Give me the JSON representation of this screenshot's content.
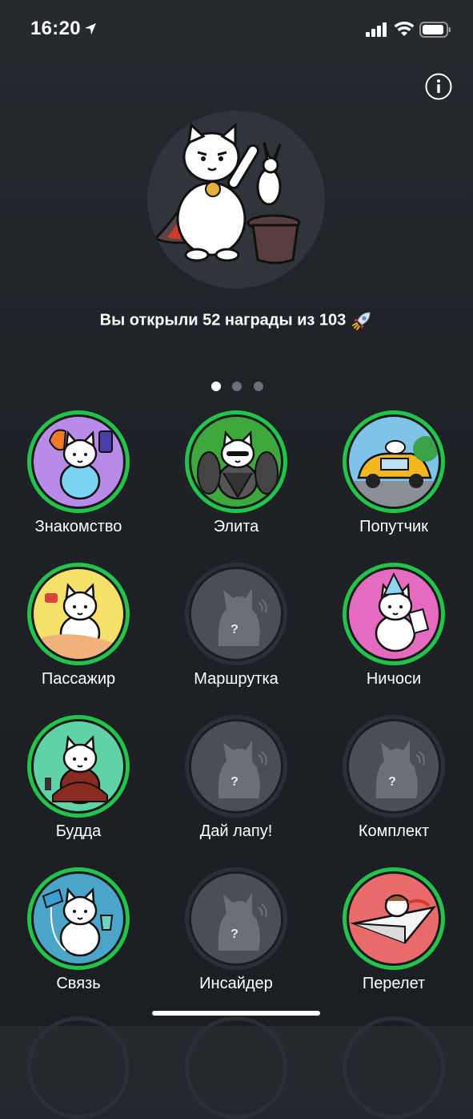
{
  "status_bar": {
    "time": "16:20"
  },
  "summary": {
    "text": "Вы открыли 52 награды из 103",
    "emoji": "rocket"
  },
  "pager": {
    "pages": 3,
    "active": 0
  },
  "colors": {
    "ring_open": "#22c44a",
    "ring_locked": "#2b3036",
    "background": "#1e2227"
  },
  "badges": [
    {
      "label": "Знакомство",
      "state": "open",
      "art": "selfie",
      "bg": "#b98be8"
    },
    {
      "label": "Элита",
      "state": "open",
      "art": "elite",
      "bg": "#3fa83c"
    },
    {
      "label": "Попутчик",
      "state": "open",
      "art": "car",
      "bg": "#7fc4e8"
    },
    {
      "label": "Пассажир",
      "state": "open",
      "art": "passenger",
      "bg": "#f5e06a"
    },
    {
      "label": "Маршрутка",
      "state": "locked",
      "art": "locked"
    },
    {
      "label": "Ничоси",
      "state": "open",
      "art": "party",
      "bg": "#e56bc0"
    },
    {
      "label": "Будда",
      "state": "open",
      "art": "buddha",
      "bg": "#5fd3a6"
    },
    {
      "label": "Дай лапу!",
      "state": "locked",
      "art": "locked"
    },
    {
      "label": "Комплект",
      "state": "locked",
      "art": "locked"
    },
    {
      "label": "Связь",
      "state": "open",
      "art": "phone",
      "bg": "#4aa5c9"
    },
    {
      "label": "Инсайдер",
      "state": "locked",
      "art": "locked"
    },
    {
      "label": "Перелет",
      "state": "open",
      "art": "plane",
      "bg": "#e86a6a"
    }
  ]
}
